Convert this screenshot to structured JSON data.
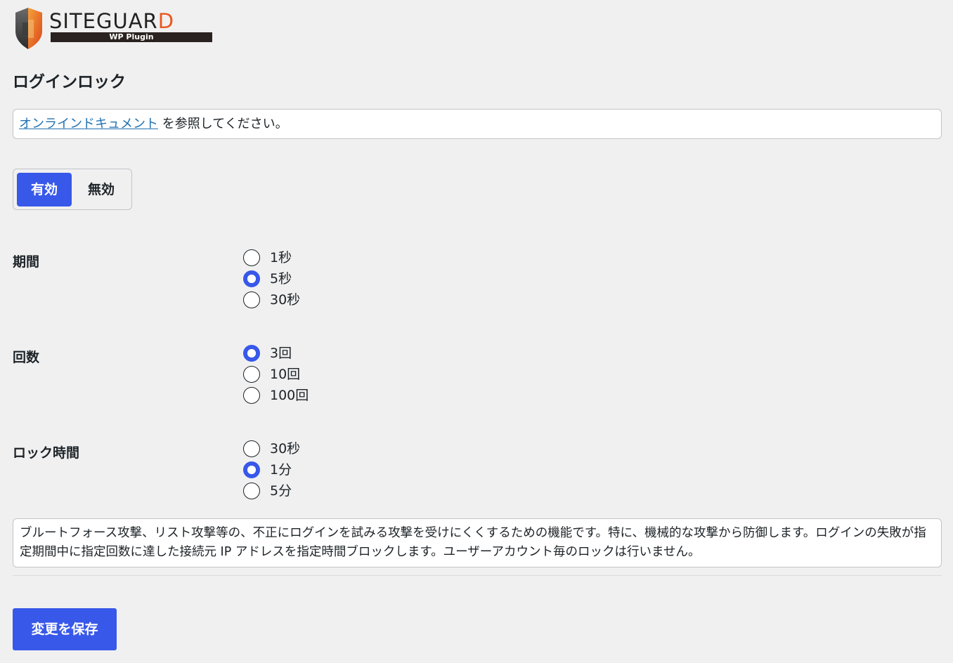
{
  "logo": {
    "word_main": "SITEGUAR",
    "word_accent": "D",
    "subtitle": "WP Plugin",
    "colors": {
      "orange": "#e8581f",
      "dark": "#2a2220"
    }
  },
  "page_title": "ログインロック",
  "notice": {
    "link_text": "オンラインドキュメント",
    "suffix": " を参照してください。"
  },
  "toggle": {
    "on_label": "有効",
    "off_label": "無効",
    "selected": "有効"
  },
  "settings": {
    "period": {
      "label": "期間",
      "options": [
        "1秒",
        "5秒",
        "30秒"
      ],
      "selected": "5秒"
    },
    "count": {
      "label": "回数",
      "options": [
        "3回",
        "10回",
        "100回"
      ],
      "selected": "3回"
    },
    "lock_time": {
      "label": "ロック時間",
      "options": [
        "30秒",
        "1分",
        "5分"
      ],
      "selected": "1分"
    }
  },
  "description": "ブルートフォース攻撃、リスト攻撃等の、不正にログインを試みる攻撃を受けにくくするための機能です。特に、機械的な攻撃から防御します。ログインの失敗が指定期間中に指定回数に達した接続元 IP アドレスを指定時間ブロックします。ユーザーアカウント毎のロックは行いません。",
  "save_label": "変更を保存",
  "colors": {
    "accent": "#3858e9",
    "link": "#2271b1",
    "background": "#f0f0f1"
  }
}
